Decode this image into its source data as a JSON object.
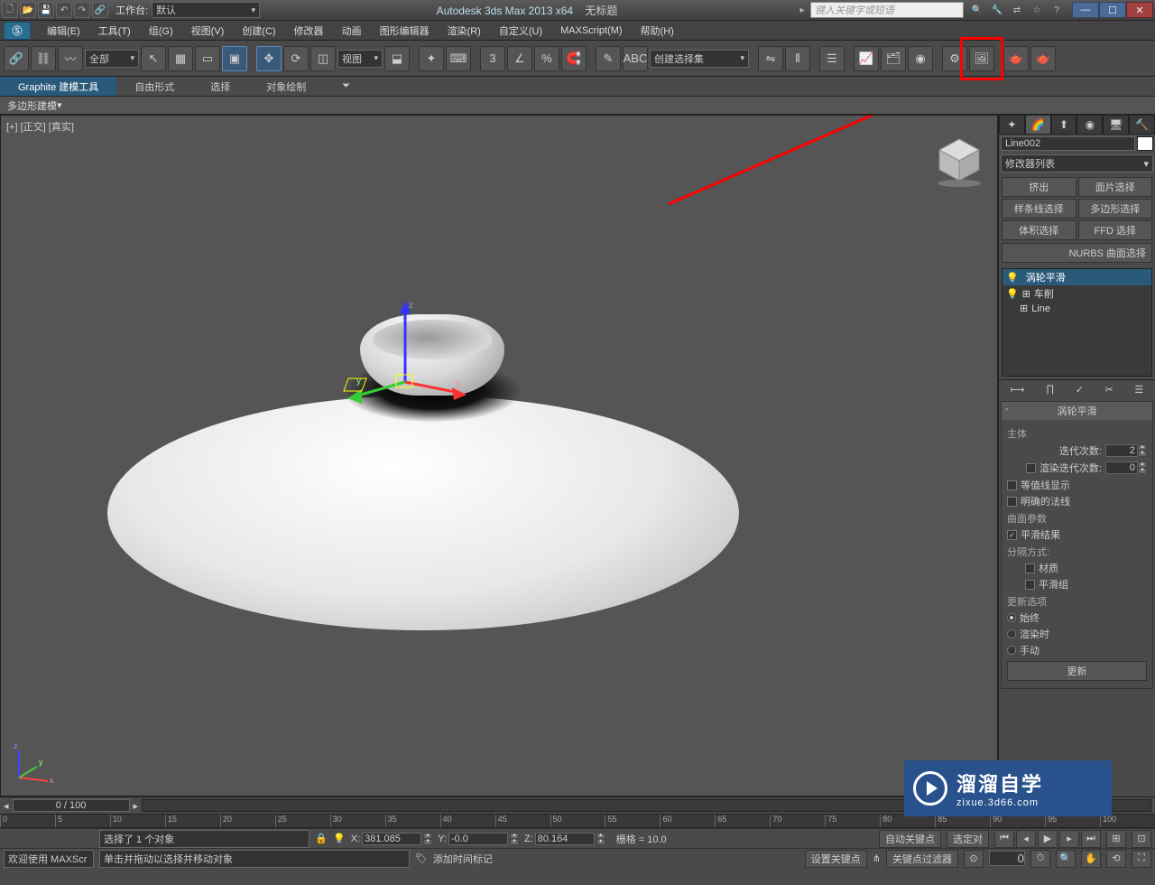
{
  "titlebar": {
    "workspace_label": "工作台:",
    "workspace_value": "默认",
    "app_title": "Autodesk 3ds Max  2013 x64",
    "doc_title": "无标题",
    "search_placeholder": "键入关键字或短语"
  },
  "menubar": {
    "items": [
      "编辑(E)",
      "工具(T)",
      "组(G)",
      "视图(V)",
      "创建(C)",
      "修改器",
      "动画",
      "图形编辑器",
      "渲染(R)",
      "自定义(U)",
      "MAXScript(M)",
      "帮助(H)"
    ]
  },
  "toolbar": {
    "filter_dd": "全部",
    "view_dd": "视图",
    "sel_set_dd": "创建选择集"
  },
  "ribbon": {
    "tabs": [
      "Graphite 建模工具",
      "自由形式",
      "选择",
      "对象绘制"
    ],
    "subtab": "多边形建模"
  },
  "viewport": {
    "label": "[+] [正交] [真实]",
    "axes": {
      "x": "x",
      "y": "y",
      "z": "z"
    }
  },
  "cmd_panel": {
    "object_name": "Line002",
    "mod_list_label": "修改器列表",
    "sel_buttons": [
      "挤出",
      "面片选择",
      "样条线选择",
      "多边形选择",
      "体积选择",
      "FFD 选择"
    ],
    "nurbs_label": "NURBS 曲面选择",
    "stack": [
      {
        "label": "涡轮平滑",
        "icon": "💡",
        "expand": ""
      },
      {
        "label": "车削",
        "icon": "💡",
        "expand": "⊞"
      },
      {
        "label": "Line",
        "icon": "",
        "expand": "⊞"
      }
    ],
    "rollout_title": "涡轮平滑",
    "group_main": "主体",
    "iterations_label": "迭代次数:",
    "iterations_value": "2",
    "render_iters_label": "渲染迭代次数:",
    "render_iters_value": "0",
    "isoline_label": "等值线显示",
    "explicit_normals_label": "明确的法线",
    "surface_params": "曲面参数",
    "smooth_result_label": "平滑结果",
    "separate_by": "分隔方式:",
    "materials_label": "材质",
    "smoothing_groups_label": "平滑组",
    "update_options": "更新选项",
    "update_always": "始终",
    "update_render": "渲染时",
    "update_manual": "手动",
    "update_btn": "更新"
  },
  "timeline": {
    "slider": "0 / 100",
    "ticks": [
      "0",
      "5",
      "10",
      "15",
      "20",
      "25",
      "30",
      "35",
      "40",
      "45",
      "50",
      "55",
      "60",
      "65",
      "70",
      "75",
      "80",
      "85",
      "90",
      "95",
      "100"
    ]
  },
  "status": {
    "welcome": "欢迎使用  MAXScr",
    "sel_msg": "选择了 1 个对象",
    "hint_msg": "单击并拖动以选择并移动对象",
    "x_label": "X:",
    "x_val": "381.085",
    "y_label": "Y:",
    "y_val": "-0.0",
    "z_label": "Z:",
    "z_val": "80.164",
    "grid": "栅格 = 10.0",
    "add_time_tag": "添加时间标记",
    "auto_key": "自动关键点",
    "set_key": "设置关键点",
    "sel_obj": "选定对",
    "key_filters": "关键点过滤器",
    "frame": "0"
  },
  "watermark": {
    "main": "溜溜自学",
    "sub": "zixue.3d66.com"
  }
}
